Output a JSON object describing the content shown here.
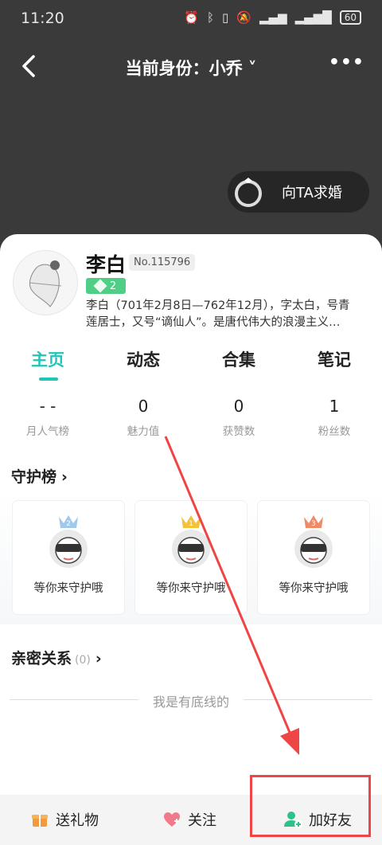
{
  "status_bar": {
    "time": "11:20",
    "battery": "60"
  },
  "nav": {
    "title": "当前身份：小乔",
    "more_label": "•••"
  },
  "propose_button": {
    "label": "向TA求婚"
  },
  "profile": {
    "name": "李白",
    "user_no": "No.115796",
    "level": "2",
    "bio_line1": "李白（701年2月8日—762年12月），字太白，号青",
    "bio_line2": "莲居士，又号“谪仙人”。是唐代伟大的浪漫主义…"
  },
  "tabs": [
    {
      "label": "主页",
      "active": true
    },
    {
      "label": "动态",
      "active": false
    },
    {
      "label": "合集",
      "active": false
    },
    {
      "label": "笔记",
      "active": false
    }
  ],
  "stats": [
    {
      "value": "- -",
      "label": "月人气榜"
    },
    {
      "value": "0",
      "label": "魅力值"
    },
    {
      "value": "0",
      "label": "获赞数"
    },
    {
      "value": "1",
      "label": "粉丝数"
    }
  ],
  "guard": {
    "title": "守护榜",
    "cards": [
      {
        "rank": "2",
        "text": "等你来守护哦",
        "crown_color": "#9fc8ea"
      },
      {
        "rank": "1",
        "text": "等你来守护哦",
        "crown_color": "#f2c23a"
      },
      {
        "rank": "3",
        "text": "等你来守护哦",
        "crown_color": "#f08a66"
      }
    ]
  },
  "intimacy": {
    "title": "亲密关系",
    "count": "(0)"
  },
  "bottom_line": "我是有底线的",
  "bottom_bar": {
    "gift": "送礼物",
    "follow": "关注",
    "add_friend": "加好友"
  },
  "colors": {
    "accent": "#20c5b8",
    "level_green": "#4fcf86",
    "annotation_red": "#ef4545"
  }
}
